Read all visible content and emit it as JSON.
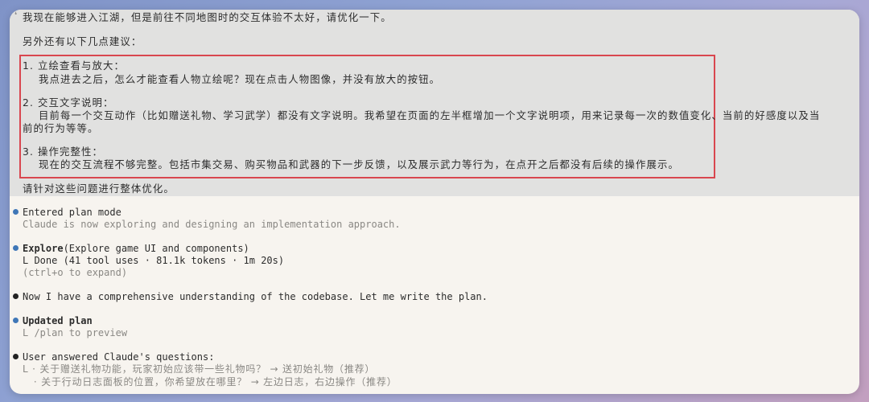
{
  "user_message": {
    "line1": "我现在能够进入江湖，但是前往不同地图时的交互体验不太好，请优化一下。",
    "line2": "另外还有以下几点建议：",
    "items": [
      {
        "title": "1. 立绘查看与放大：",
        "body": [
          "我点进去之后，怎么才能查看人物立绘呢？现在点击人物图像，并没有放大的按钮。"
        ]
      },
      {
        "title": "2. 交互文字说明：",
        "body": [
          "目前每一个交互动作（比如赠送礼物、学习武学）都没有文字说明。我希望在页面的左半框增加一个文字说明项，用来记录每一次的数值变化、当前的好感度以及当",
          "前的行为等等。"
        ]
      },
      {
        "title": "3. 操作完整性：",
        "body": [
          "现在的交互流程不够完整。包括市集交易、购买物品和武器的下一步反馈，以及展示武力等行为，在点开之后都没有后续的操作展示。"
        ]
      }
    ],
    "closing": "请针对这些问题进行整体优化。"
  },
  "log": {
    "plan_mode": {
      "title": "Entered plan mode",
      "subtitle": "Claude is now exploring and designing an implementation approach."
    },
    "explore": {
      "name": "Explore",
      "args": "(Explore game UI and components)",
      "result": "L  Done (41 tool uses · 81.1k tokens · 1m 20s)",
      "hint": "(ctrl+o to expand)"
    },
    "message": "Now I have a comprehensive understanding of the codebase. Let me write the plan.",
    "updated_plan": {
      "title": "Updated plan",
      "detail": "L  /plan to preview"
    },
    "answers": {
      "title": "User answered Claude's questions:",
      "q1": "L  · 关于赠送礼物功能，玩家初始应该带一些礼物吗？ → 送初始礼物（推荐）",
      "q2": "   · 关于行动日志面板的位置，你希望放在哪里？ → 左边日志，右边操作（推荐）"
    }
  },
  "colors": {
    "highlight_box": "#d9474f",
    "bullet_blue": "#3f77b7",
    "user_block_bg": "#e1e1e0",
    "terminal_bg": "#f7f4ef"
  }
}
